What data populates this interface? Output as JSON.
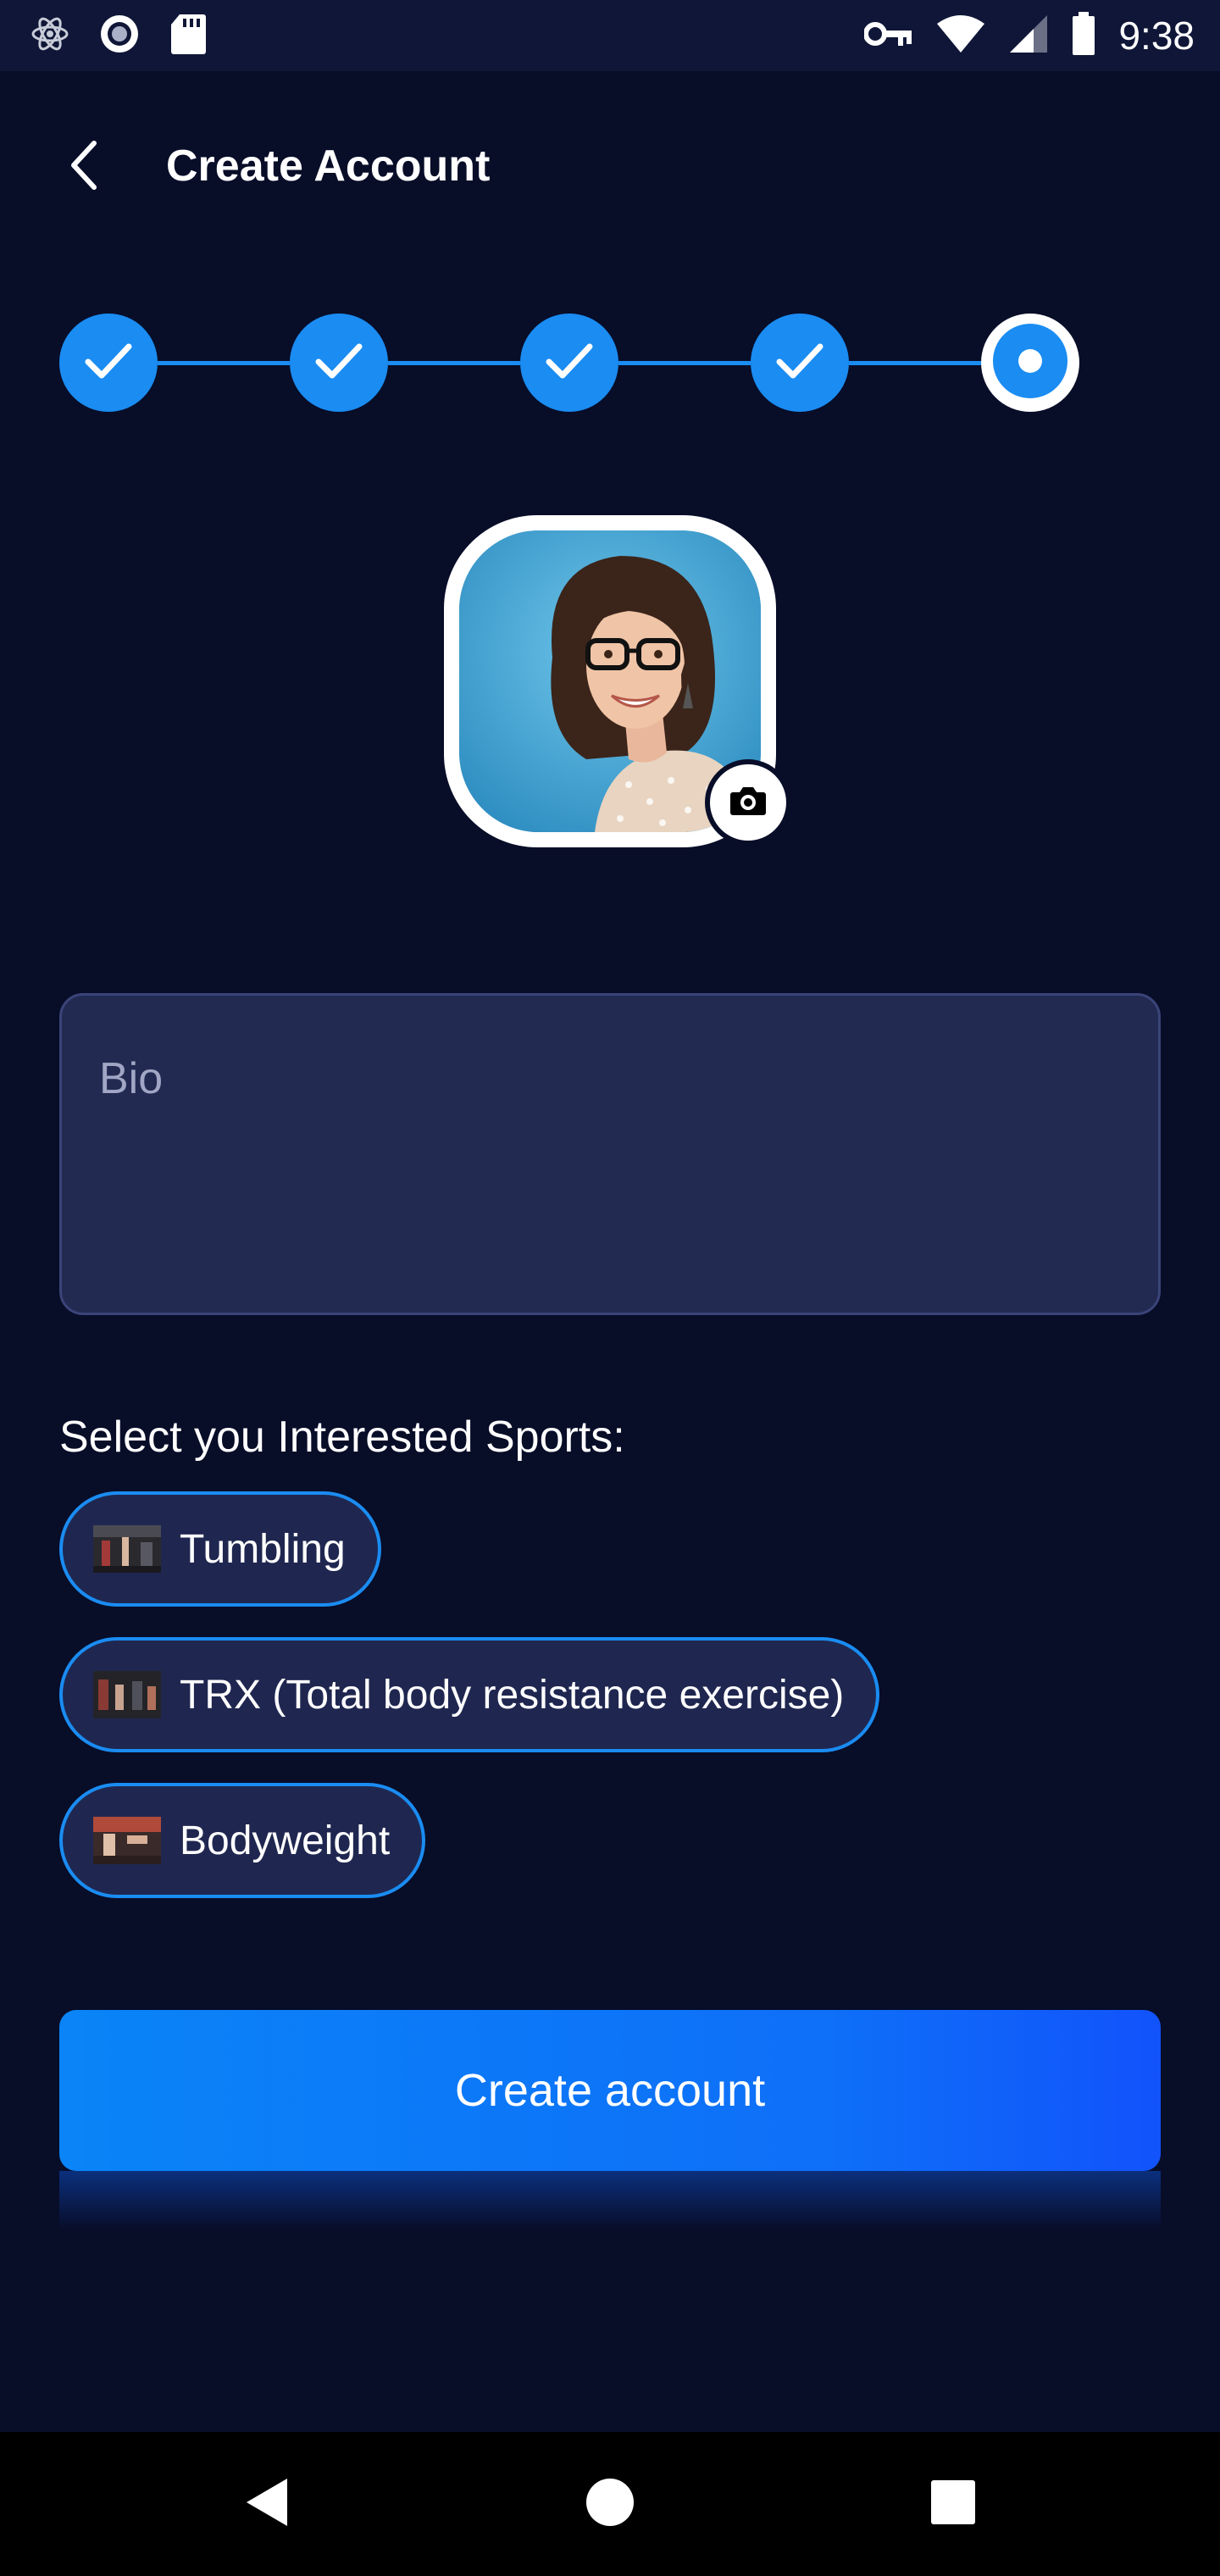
{
  "status_bar": {
    "time": "9:38",
    "left_icons": [
      "atom-icon",
      "record-icon",
      "sd-card-icon"
    ],
    "right_icons": [
      "key-icon",
      "wifi-icon",
      "signal-icon",
      "battery-icon"
    ]
  },
  "header": {
    "back_icon": "chevron-left-icon",
    "title": "Create Account"
  },
  "stepper": {
    "total_steps": 5,
    "completed_steps": 4,
    "current_step": 5
  },
  "profile": {
    "camera_icon": "camera-icon"
  },
  "bio": {
    "placeholder": "Bio",
    "value": ""
  },
  "sports": {
    "label": "Select you Interested Sports:",
    "items": [
      {
        "label": "Tumbling"
      },
      {
        "label": "TRX (Total body resistance exercise)"
      },
      {
        "label": "Bodyweight"
      }
    ]
  },
  "create_button": {
    "label": "Create account"
  },
  "nav_bar": {
    "icons": [
      "back-triangle-icon",
      "home-circle-icon",
      "recents-square-icon"
    ]
  },
  "colors": {
    "background": "#080d28",
    "status_bar": "#0f1637",
    "accent": "#1a8cf2",
    "field_bg": "#222a52",
    "chip_bg": "#1f2750",
    "button_gradient_start": "#0a84f7",
    "button_gradient_end": "#1253fb"
  }
}
